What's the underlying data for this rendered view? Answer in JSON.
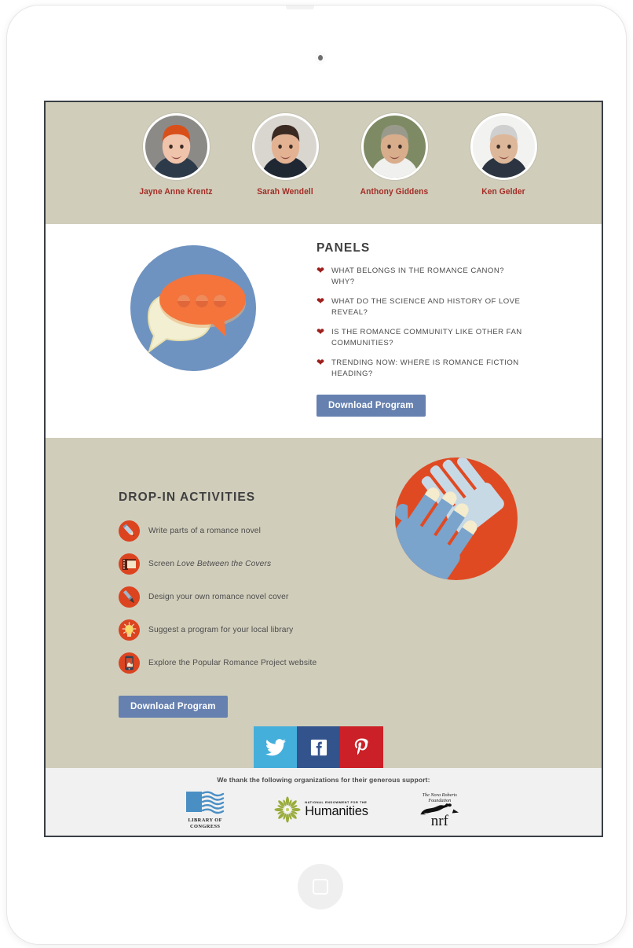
{
  "device": {
    "type": "tablet",
    "camera_icon": "camera-dot",
    "home_icon": "home-square-icon"
  },
  "speakers": {
    "items": [
      {
        "name": "Jayne Anne Krentz",
        "hair": "#d94f1a",
        "skin": "#f0c3ab",
        "bg": "#8c8a87",
        "shirt": "#2c3a4a"
      },
      {
        "name": "Sarah Wendell",
        "hair": "#3a2a22",
        "skin": "#e3b293",
        "bg": "#d9d6cf",
        "shirt": "#1f2733"
      },
      {
        "name": "Anthony Giddens",
        "hair": "#9a9a8c",
        "skin": "#d8ad8c",
        "bg": "#7e8a63",
        "shirt": "#f0f0ee"
      },
      {
        "name": "Ken Gelder",
        "hair": "#cfcfcf",
        "skin": "#ddb79a",
        "bg": "#f2f2f0",
        "shirt": "#2b3440"
      }
    ],
    "name_color": "#a32d25",
    "strip_bg": "#d0cdbb"
  },
  "panels": {
    "title": "PANELS",
    "bullet_icon": "heart-bullet-icon",
    "illustration": "speech-bubbles-illustration",
    "items": [
      "WHAT BELONGS IN THE ROMANCE CANON? WHY?",
      "WHAT DO THE SCIENCE AND HISTORY OF LOVE REVEAL?",
      "IS THE ROMANCE COMMUNITY LIKE OTHER FAN COMMUNITIES?",
      "TRENDING NOW: WHERE IS ROMANCE FICTION HEADING?"
    ],
    "download_label": "Download Program",
    "button_color": "#6681b0"
  },
  "activities": {
    "title": "DROP-IN ACTIVITIES",
    "illustration": "helping-hands-illustration",
    "icon_color": "#dc4420",
    "items": [
      {
        "icon": "pencil-icon",
        "text": "Write parts of a romance novel"
      },
      {
        "icon": "film-strip-icon",
        "text_before": "Screen ",
        "text_italic": "Love Between the Covers",
        "text": "Screen Love Between the Covers"
      },
      {
        "icon": "paintbrush-icon",
        "text": "Design your own romance novel cover"
      },
      {
        "icon": "lightbulb-icon",
        "text": "Suggest a program for your local library"
      },
      {
        "icon": "mobile-phone-icon",
        "text": "Explore the Popular Romance Project website"
      }
    ],
    "download_label": "Download Program"
  },
  "social": {
    "items": [
      {
        "icon": "twitter-icon",
        "label": "Twitter",
        "color": "#45afdc"
      },
      {
        "icon": "facebook-icon",
        "label": "Facebook",
        "color": "#33538d"
      },
      {
        "icon": "pinterest-icon",
        "label": "Pinterest",
        "color": "#cb2027"
      }
    ]
  },
  "footer": {
    "thanks": "We thank the following organizations for their generous support:",
    "sponsors": [
      {
        "name": "LIBRARY OF CONGRESS",
        "line1": "LIBRARY OF",
        "line2": "CONGRESS",
        "icon": "library-of-congress-logo",
        "color": "#4a8fc4"
      },
      {
        "name": "NATIONAL ENDOWMENT FOR THE Humanities",
        "small": "NATIONAL ENDOWMENT FOR THE",
        "big": "Humanities",
        "icon": "neh-starburst-logo",
        "color": "#9aac3c"
      },
      {
        "name": "The Nora Roberts Foundation",
        "line1": "The Nora Roberts",
        "line2": "Foundation",
        "mark": "nrf",
        "icon": "nora-roberts-foundation-logo",
        "color": "#111111"
      }
    ]
  }
}
